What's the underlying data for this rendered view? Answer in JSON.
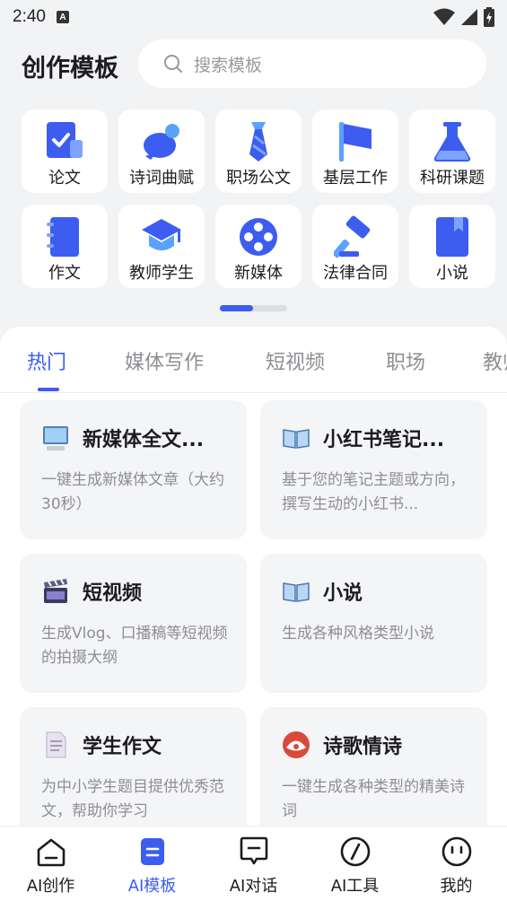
{
  "status_bar": {
    "time": "2:40",
    "indicator": "A"
  },
  "header": {
    "title": "创作模板",
    "search_placeholder": "搜索模板"
  },
  "categories": [
    {
      "label": "论文",
      "icon": "checklist-icon"
    },
    {
      "label": "诗词曲赋",
      "icon": "bird-icon"
    },
    {
      "label": "职场公文",
      "icon": "necktie-icon"
    },
    {
      "label": "基层工作",
      "icon": "flag-icon"
    },
    {
      "label": "科研课题",
      "icon": "flask-icon"
    },
    {
      "label": "作文",
      "icon": "notebook-icon"
    },
    {
      "label": "教师学生",
      "icon": "graduation-cap-icon"
    },
    {
      "label": "新媒体",
      "icon": "film-reel-icon"
    },
    {
      "label": "法律合同",
      "icon": "gavel-icon"
    },
    {
      "label": "小说",
      "icon": "book-icon"
    }
  ],
  "tabs": [
    "热门",
    "媒体写作",
    "短视频",
    "职场",
    "教师"
  ],
  "templates": [
    {
      "title": "新媒体全文...",
      "desc": "一键生成新媒体文章（大约30秒）",
      "icon": "computer-icon"
    },
    {
      "title": "小红书笔记...",
      "desc": "基于您的笔记主题或方向，撰写生动的小红书...",
      "icon": "open-book-icon"
    },
    {
      "title": "短视频",
      "desc": "生成Vlog、口播稿等短视频的拍摄大纲",
      "icon": "clapperboard-icon"
    },
    {
      "title": "小说",
      "desc": "生成各种风格类型小说",
      "icon": "open-book-icon"
    },
    {
      "title": "学生作文",
      "desc": "为中小学生题目提供优秀范文，帮助你学习",
      "icon": "document-icon"
    },
    {
      "title": "诗歌情诗",
      "desc": "一键生成各种类型的精美诗词",
      "icon": "fan-icon"
    }
  ],
  "bottom_nav": [
    {
      "label": "AI创作",
      "icon": "home-icon"
    },
    {
      "label": "AI模板",
      "icon": "template-icon"
    },
    {
      "label": "AI对话",
      "icon": "chat-icon"
    },
    {
      "label": "AI工具",
      "icon": "compass-icon"
    },
    {
      "label": "我的",
      "icon": "smile-icon"
    }
  ],
  "colors": {
    "accent": "#3d5df0",
    "background": "#f2f3f5",
    "card": "#ffffff",
    "muted": "#8e8e93"
  }
}
